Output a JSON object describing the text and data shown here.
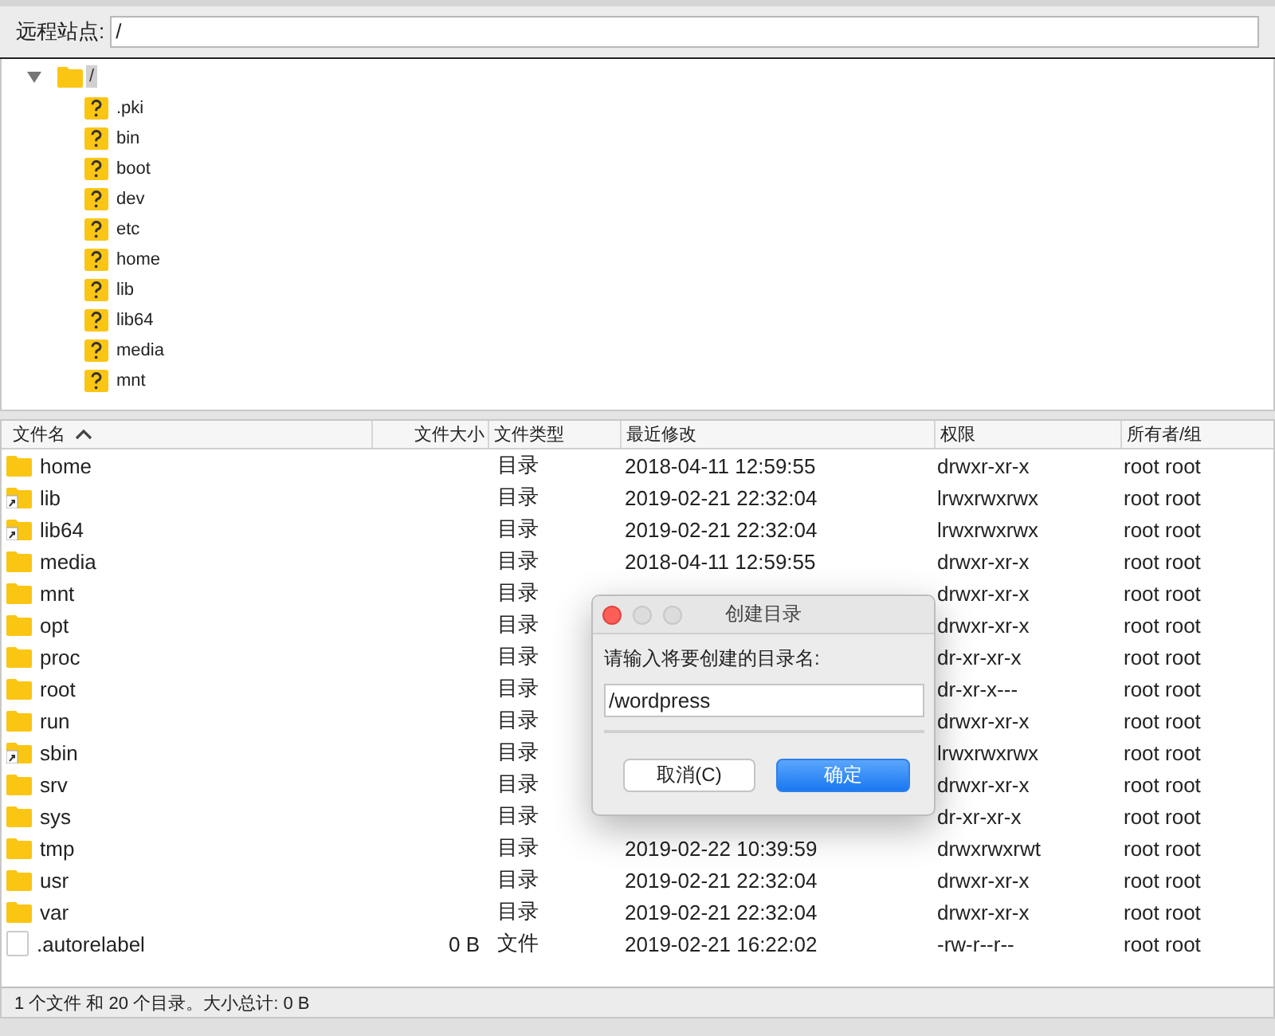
{
  "remote_site": {
    "label": "远程站点:",
    "value": "/"
  },
  "tree": {
    "root": {
      "label": "/",
      "expanded": true,
      "selected": true,
      "children": [
        {
          "label": ".pki"
        },
        {
          "label": "bin"
        },
        {
          "label": "boot"
        },
        {
          "label": "dev"
        },
        {
          "label": "etc"
        },
        {
          "label": "home"
        },
        {
          "label": "lib"
        },
        {
          "label": "lib64"
        },
        {
          "label": "media"
        },
        {
          "label": "mnt"
        }
      ]
    }
  },
  "file_list": {
    "columns": [
      {
        "label": "文件名",
        "sorted": true
      },
      {
        "label": "文件大小",
        "sorted": false
      },
      {
        "label": "文件类型",
        "sorted": false
      },
      {
        "label": "最近修改",
        "sorted": false
      },
      {
        "label": "权限",
        "sorted": false
      },
      {
        "label": "所有者/组",
        "sorted": false
      }
    ],
    "rows": [
      {
        "name": "home",
        "kind": "folder",
        "type": "目录",
        "modified": "2018-04-11 12:59:55",
        "permissions": "drwxr-xr-x",
        "owner": "root root"
      },
      {
        "name": "lib",
        "kind": "link",
        "type": "目录",
        "modified": "2019-02-21 22:32:04",
        "permissions": "lrwxrwxrwx",
        "owner": "root root"
      },
      {
        "name": "lib64",
        "kind": "link",
        "type": "目录",
        "modified": "2019-02-21 22:32:04",
        "permissions": "lrwxrwxrwx",
        "owner": "root root"
      },
      {
        "name": "media",
        "kind": "folder",
        "type": "目录",
        "modified": "2018-04-11 12:59:55",
        "permissions": "drwxr-xr-x",
        "owner": "root root"
      },
      {
        "name": "mnt",
        "kind": "folder",
        "type": "目录",
        "permissions": "drwxr-xr-x",
        "owner": "root root"
      },
      {
        "name": "opt",
        "kind": "folder",
        "type": "目录",
        "permissions": "drwxr-xr-x",
        "owner": "root root"
      },
      {
        "name": "proc",
        "kind": "folder",
        "type": "目录",
        "permissions": "dr-xr-xr-x",
        "owner": "root root"
      },
      {
        "name": "root",
        "kind": "folder",
        "type": "目录",
        "permissions": "dr-xr-x---",
        "owner": "root root"
      },
      {
        "name": "run",
        "kind": "folder",
        "type": "目录",
        "permissions": "drwxr-xr-x",
        "owner": "root root"
      },
      {
        "name": "sbin",
        "kind": "link",
        "type": "目录",
        "permissions": "lrwxrwxrwx",
        "owner": "root root"
      },
      {
        "name": "srv",
        "kind": "folder",
        "type": "目录",
        "permissions": "drwxr-xr-x",
        "owner": "root root"
      },
      {
        "name": "sys",
        "kind": "folder",
        "type": "目录",
        "permissions": "dr-xr-xr-x",
        "owner": "root root"
      },
      {
        "name": "tmp",
        "kind": "folder",
        "type": "目录",
        "modified": "2019-02-22 10:39:59",
        "permissions": "drwxrwxrwt",
        "owner": "root root"
      },
      {
        "name": "usr",
        "kind": "folder",
        "type": "目录",
        "modified": "2019-02-21 22:32:04",
        "permissions": "drwxr-xr-x",
        "owner": "root root"
      },
      {
        "name": "var",
        "kind": "folder",
        "type": "目录",
        "modified": "2019-02-21 22:32:04",
        "permissions": "drwxr-xr-x",
        "owner": "root root"
      },
      {
        "name": ".autorelabel",
        "kind": "file",
        "size": "0 B",
        "type": "文件",
        "modified": "2019-02-21 16:22:02",
        "permissions": "-rw-r--r--",
        "owner": "root root"
      }
    ]
  },
  "status_bar": {
    "text": "1 个文件 和 20 个目录。大小总计: 0 B"
  },
  "dialog": {
    "title": "创建目录",
    "prompt": "请输入将要创建的目录名:",
    "value": "/wordpress",
    "buttons": [
      {
        "label": "取消(C)",
        "default": false
      },
      {
        "label": "确定",
        "default": true
      }
    ]
  }
}
